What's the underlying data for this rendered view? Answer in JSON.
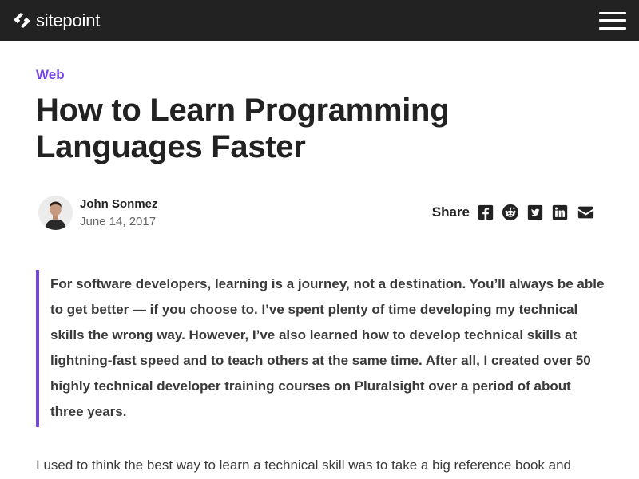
{
  "header": {
    "brand_name": "sitepoint",
    "logo_icon": "sitepoint-logo-icon",
    "menu_icon": "hamburger-menu-icon",
    "background_color": "#222222"
  },
  "article": {
    "category": "Web",
    "title_line_1": "How to Learn Programming",
    "title_line_2": "Languages Faster",
    "author": {
      "name": "John Sonmez",
      "date": "June 14, 2017",
      "avatar_icon": "author-avatar"
    },
    "share": {
      "label": "Share",
      "icons": [
        "facebook-icon",
        "reddit-icon",
        "twitter-icon",
        "linkedin-icon",
        "email-icon"
      ]
    },
    "lead_paragraph": "For software developers, learning is a journey, not a destination. You’ll always be able to get better — if you choose to. I’ve spent plenty of time developing my technical skills the wrong way. However, I’ve also learned how to develop technical skills at lightning-fast speed and to teach others at the same time. After all, I created over 50 highly technical developer training courses on Pluralsight over a period of about three years.",
    "body_paragraph": "I used to think the best way to learn a technical skill was to take a big reference book and"
  },
  "colors": {
    "accent": "#7544e4",
    "text": "#222222",
    "muted": "#666666"
  }
}
